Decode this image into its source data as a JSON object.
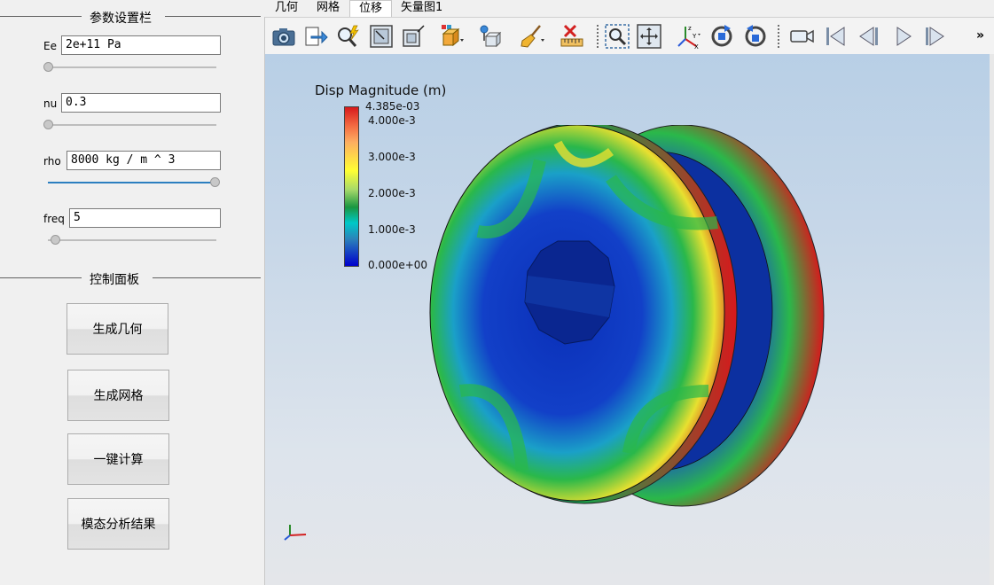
{
  "param_panel": {
    "title": "参数设置栏",
    "params": [
      {
        "label": "Ee",
        "value": "2e+11 Pa",
        "slider_fraction": 0.0
      },
      {
        "label": "nu",
        "value": "0.3",
        "slider_fraction": 0.0
      },
      {
        "label": "rho",
        "value": "8000 kg / m ^ 3",
        "slider_fraction": 1.0
      },
      {
        "label": "freq",
        "value": "5",
        "slider_fraction": 0.04
      }
    ]
  },
  "control_panel": {
    "title": "控制面板",
    "buttons": [
      "生成几何",
      "生成网格",
      "一键计算",
      "模态分析结果"
    ]
  },
  "tabs": [
    "几何",
    "网格",
    "位移",
    "矢量图1"
  ],
  "active_tab": "位移",
  "toolbar": {
    "icons": [
      "camera-icon",
      "export-icon",
      "zoom-icon",
      "reset-camera-icon",
      "box-icon",
      "cube-icon",
      "probe-icon",
      "clear-brush-icon",
      "delete-ruler-icon",
      "zoom-to-box-icon",
      "fit-view-icon",
      "axes-icon",
      "rotate-cw-icon",
      "rotate-ccw-icon",
      "video-camera-icon",
      "first-frame-icon",
      "previous-frame-icon",
      "play-icon",
      "last-frame-icon",
      "more-icon"
    ],
    "overflow_label": "»"
  },
  "viewport": {
    "legend": {
      "title": "Disp Magnitude (m)",
      "ticks": [
        "4.385e-03",
        "4.000e-3",
        "3.000e-3",
        "2.000e-3",
        "1.000e-3",
        "0.000e+00"
      ],
      "colors": [
        "#d7191c",
        "#fdae61",
        "#ffff33",
        "#1a9641",
        "#2b83ba",
        "#0000cc"
      ]
    }
  }
}
